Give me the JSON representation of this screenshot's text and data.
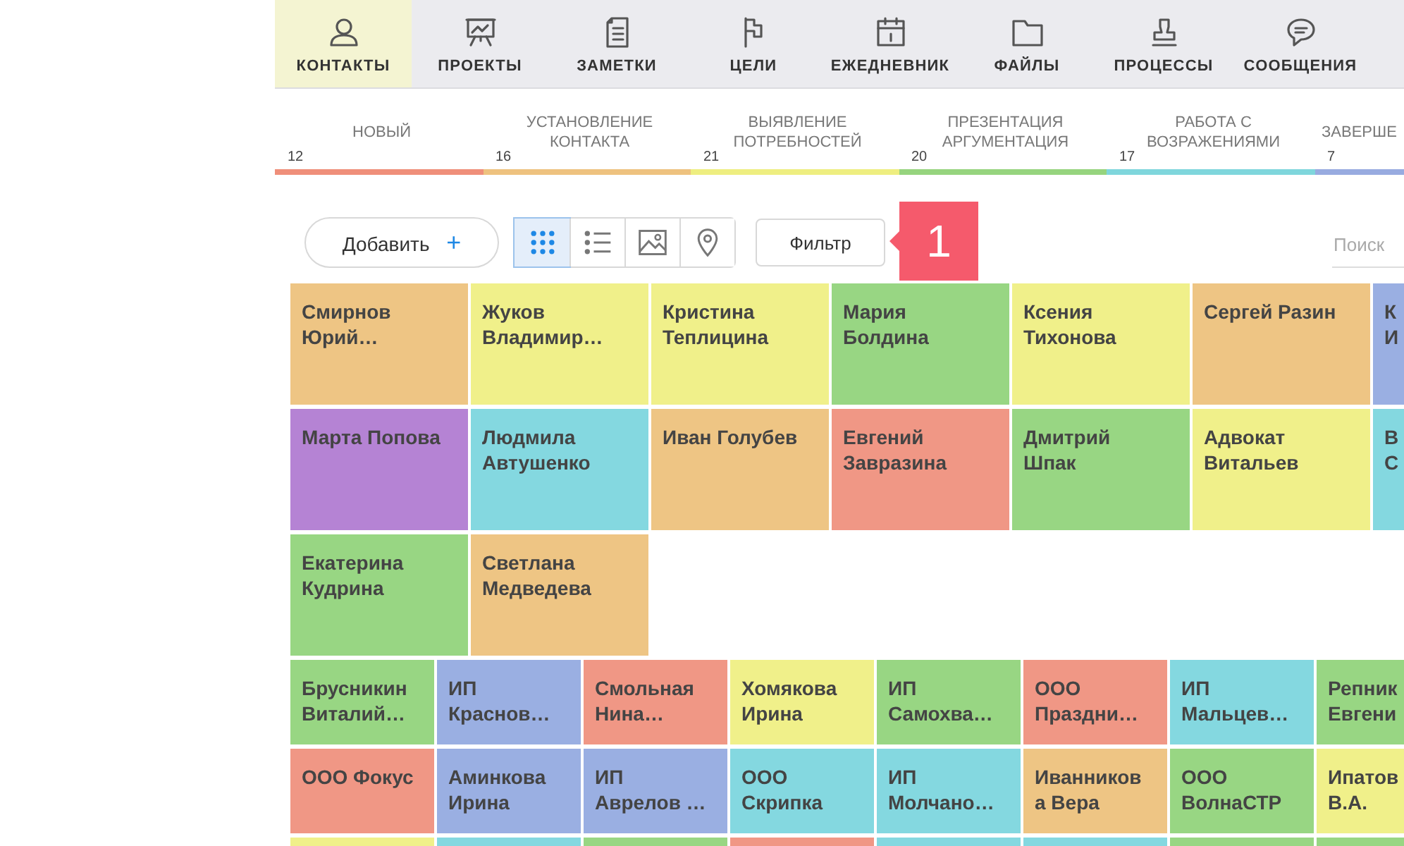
{
  "nav": [
    {
      "label": "КОНТАКТЫ",
      "selected": true
    },
    {
      "label": "ПРОЕКТЫ",
      "selected": false
    },
    {
      "label": "ЗАМЕТКИ",
      "selected": false
    },
    {
      "label": "ЦЕЛИ",
      "selected": false
    },
    {
      "label": "ЕЖЕДНЕВНИК",
      "selected": false
    },
    {
      "label": "ФАЙЛЫ",
      "selected": false
    },
    {
      "label": "ПРОЦЕССЫ",
      "selected": false
    },
    {
      "label": "СООБЩЕНИЯ",
      "selected": false
    }
  ],
  "stages": [
    {
      "label": "НОВЫЙ",
      "count": "12",
      "color": "#ef8f7a"
    },
    {
      "label": "УСТАНОВЛЕНИЕ\nКОНТАКТА",
      "count": "16",
      "color": "#eec27f"
    },
    {
      "label": "ВЫЯВЛЕНИЕ\nПОТРЕБНОСТЕЙ",
      "count": "21",
      "color": "#eeee80"
    },
    {
      "label": "ПРЕЗЕНТАЦИЯ\nАРГУМЕНТАЦИЯ",
      "count": "20",
      "color": "#96d47e"
    },
    {
      "label": "РАБОТА С\nВОЗРАЖЕНИЯМИ",
      "count": "17",
      "color": "#7fd6dc"
    },
    {
      "label": "ЗАВЕРШЕ",
      "count": "7",
      "color": "#98abe0"
    }
  ],
  "toolbar": {
    "add_label": "Добавить",
    "add_icon": "+",
    "views": [
      {
        "selected": true
      },
      {
        "selected": false
      },
      {
        "selected": false
      },
      {
        "selected": false
      }
    ],
    "filter_label": "Фильтр",
    "badge": "1",
    "search": {
      "placeholder": "Поиск"
    }
  },
  "tile_groups": [
    {
      "kind": "large",
      "rows": [
        [
          {
            "name": "Смирнов\nЮрий…",
            "color": "#eec584"
          },
          {
            "name": "Жуков\nВладимир…",
            "color": "#f0f08a"
          },
          {
            "name": "Кристина\nТеплицина",
            "color": "#f0f08a"
          },
          {
            "name": "Мария\nБолдина",
            "color": "#98d683"
          },
          {
            "name": "Ксения\nТихонова",
            "color": "#f0f08a"
          },
          {
            "name": "Сергей Разин",
            "color": "#eec584"
          },
          {
            "name": "К\nИ",
            "color": "#9aafe2"
          }
        ],
        [
          {
            "name": "Марта Попова",
            "color": "#b583d4"
          },
          {
            "name": "Людмила\nАвтушенко",
            "color": "#84d8e0"
          },
          {
            "name": "Иван Голубев",
            "color": "#eec584"
          },
          {
            "name": "Евгений\nЗавразина",
            "color": "#f09785"
          },
          {
            "name": "Дмитрий\nШпак",
            "color": "#98d683"
          },
          {
            "name": "Адвокат\nВитальев",
            "color": "#f0f08a"
          },
          {
            "name": "В\nС",
            "color": "#84d8e0"
          }
        ],
        [
          {
            "name": "Екатерина\nКудрина",
            "color": "#98d683"
          },
          {
            "name": "Светлана\nМедведева",
            "color": "#eec584"
          }
        ]
      ]
    },
    {
      "kind": "small",
      "rows": [
        [
          {
            "name": "Брусникин\nВиталий…",
            "color": "#98d683"
          },
          {
            "name": "ИП\nКраснов…",
            "color": "#9aafe2"
          },
          {
            "name": "Смольная\nНина…",
            "color": "#f09785"
          },
          {
            "name": "Хомякова\nИрина",
            "color": "#f0f08a"
          },
          {
            "name": "ИП\nСамохва…",
            "color": "#98d683"
          },
          {
            "name": "ООО\nПраздни…",
            "color": "#f09785"
          },
          {
            "name": "ИП\nМальцев…",
            "color": "#84d8e0"
          },
          {
            "name": "Репник\nЕвгени",
            "color": "#98d683"
          }
        ],
        [
          {
            "name": "ООО Фокус",
            "color": "#f09785"
          },
          {
            "name": "Аминкова\nИрина",
            "color": "#9aafe2"
          },
          {
            "name": "ИП\nАврелов …",
            "color": "#9aafe2"
          },
          {
            "name": "ООО\nСкрипка",
            "color": "#84d8e0"
          },
          {
            "name": "ИП\nМолчано…",
            "color": "#84d8e0"
          },
          {
            "name": "Иванников\nа Вера",
            "color": "#eec584"
          },
          {
            "name": "ООО\nВолнаСТР",
            "color": "#98d683"
          },
          {
            "name": "Ипатов\nВ.А.",
            "color": "#f0f08a"
          }
        ],
        [
          {
            "color": "#f0f08a"
          },
          {
            "color": "#84d8e0"
          },
          {
            "color": "#98d683"
          },
          {
            "color": "#f09785"
          },
          {
            "color": "#84d8e0"
          },
          {
            "color": "#84d8e0"
          },
          {
            "color": "#98d683"
          },
          {
            "color": "#98d683"
          }
        ]
      ]
    }
  ]
}
